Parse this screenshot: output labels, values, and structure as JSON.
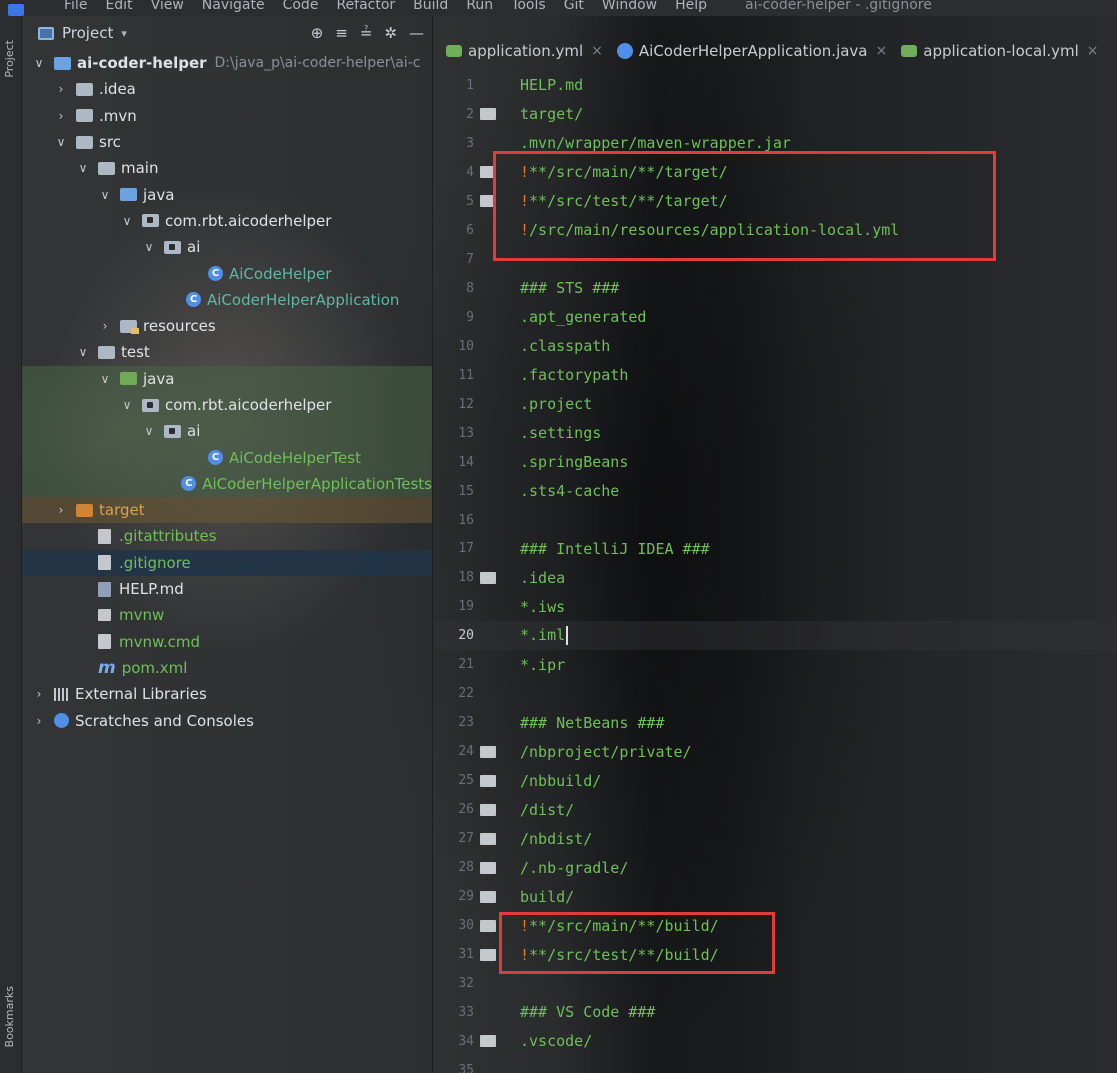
{
  "menu": {
    "items": [
      "File",
      "Edit",
      "View",
      "Navigate",
      "Code",
      "Refactor",
      "Build",
      "Run",
      "Tools",
      "Git",
      "Window",
      "Help"
    ],
    "window_title": "ai-coder-helper - .gitignore"
  },
  "toolstrip": {
    "top_label": "Project",
    "bottom_label": "Bookmarks"
  },
  "panel": {
    "title": "Project",
    "caret": "▾",
    "tools": [
      "⊕",
      "≡",
      "≟",
      "✲",
      "—"
    ]
  },
  "tree": [
    {
      "label": "ai-coder-helper",
      "path": "D:\\java_p\\ai-coder-helper\\ai-c",
      "indent": 0,
      "chev": "down",
      "icon": "proj",
      "style": "bold"
    },
    {
      "label": ".idea",
      "indent": 1,
      "chev": "right",
      "icon": "folder"
    },
    {
      "label": ".mvn",
      "indent": 1,
      "chev": "right",
      "icon": "folder"
    },
    {
      "label": "src",
      "indent": 1,
      "chev": "down",
      "icon": "folder"
    },
    {
      "label": "main",
      "indent": 2,
      "chev": "down",
      "icon": "folder"
    },
    {
      "label": "java",
      "indent": 3,
      "chev": "down",
      "icon": "folder-blue"
    },
    {
      "label": "com.rbt.aicoderhelper",
      "indent": 4,
      "chev": "down",
      "icon": "pkg"
    },
    {
      "label": "ai",
      "indent": 5,
      "chev": "down",
      "icon": "pkg"
    },
    {
      "label": "AiCodeHelper",
      "indent": 7,
      "chev": "none",
      "icon": "class",
      "style": "teal"
    },
    {
      "label": "AiCoderHelperApplication",
      "indent": 6,
      "chev": "none",
      "icon": "class",
      "style": "teal"
    },
    {
      "label": "resources",
      "indent": 3,
      "chev": "right",
      "icon": "res"
    },
    {
      "label": "test",
      "indent": 2,
      "chev": "down",
      "icon": "folder"
    },
    {
      "label": "java",
      "indent": 3,
      "chev": "down",
      "icon": "folder-green",
      "row": "hl-test"
    },
    {
      "label": "com.rbt.aicoderhelper",
      "indent": 4,
      "chev": "down",
      "icon": "pkg",
      "row": "hl-test"
    },
    {
      "label": "ai",
      "indent": 5,
      "chev": "down",
      "icon": "pkg",
      "row": "hl-test"
    },
    {
      "label": "AiCodeHelperTest",
      "indent": 7,
      "chev": "none",
      "icon": "class",
      "style": "green",
      "row": "hl-test"
    },
    {
      "label": "AiCoderHelperApplicationTests",
      "indent": 6,
      "chev": "none",
      "icon": "class",
      "style": "green",
      "row": "hl-test"
    },
    {
      "label": "target",
      "indent": 1,
      "chev": "right",
      "icon": "folder-orange",
      "style": "gold",
      "row": "hl-target"
    },
    {
      "label": ".gitattributes",
      "indent": 2,
      "chev": "none",
      "icon": "file",
      "style": "green"
    },
    {
      "label": ".gitignore",
      "indent": 2,
      "chev": "none",
      "icon": "file",
      "style": "green",
      "row": "sel"
    },
    {
      "label": "HELP.md",
      "indent": 2,
      "chev": "none",
      "icon": "md"
    },
    {
      "label": "mvnw",
      "indent": 2,
      "chev": "none",
      "icon": "mvnw",
      "style": "green"
    },
    {
      "label": "mvnw.cmd",
      "indent": 2,
      "chev": "none",
      "icon": "file",
      "style": "green"
    },
    {
      "label": "pom.xml",
      "indent": 2,
      "chev": "none",
      "icon": "maven",
      "style": "green"
    },
    {
      "label": "External Libraries",
      "indent": 0,
      "chev": "right",
      "icon": "lib"
    },
    {
      "label": "Scratches and Consoles",
      "indent": 0,
      "chev": "right",
      "icon": "scratch"
    }
  ],
  "tabs": [
    {
      "label": "application.yml",
      "icon": "yml",
      "close": "×"
    },
    {
      "label": "AiCoderHelperApplication.java",
      "icon": "java",
      "close": "×"
    },
    {
      "label": "application-local.yml",
      "icon": "yml",
      "close": "×"
    }
  ],
  "editor": {
    "current_line": 20,
    "lines": [
      {
        "n": "1",
        "text": "HELP.md",
        "fold": false
      },
      {
        "n": "2",
        "text": "target/",
        "fold": true
      },
      {
        "n": "3",
        "text": ".mvn/wrapper/maven-wrapper.jar",
        "fold": false
      },
      {
        "n": "4",
        "bang": "!",
        "text": "**/src/main/**/target/",
        "fold": true
      },
      {
        "n": "5",
        "bang": "!",
        "text": "**/src/test/**/target/",
        "fold": true
      },
      {
        "n": "6",
        "bang": "!",
        "text": "/src/main/resources/application-local.yml",
        "fold": false
      },
      {
        "n": "7",
        "text": "",
        "fold": false
      },
      {
        "n": "8",
        "text": "### STS ###",
        "fold": false
      },
      {
        "n": "9",
        "text": ".apt_generated",
        "fold": false
      },
      {
        "n": "10",
        "text": ".classpath",
        "fold": false
      },
      {
        "n": "11",
        "text": ".factorypath",
        "fold": false
      },
      {
        "n": "12",
        "text": ".project",
        "fold": false
      },
      {
        "n": "13",
        "text": ".settings",
        "fold": false
      },
      {
        "n": "14",
        "text": ".springBeans",
        "fold": false
      },
      {
        "n": "15",
        "text": ".sts4-cache",
        "fold": false
      },
      {
        "n": "16",
        "text": "",
        "fold": false
      },
      {
        "n": "17",
        "text": "### IntelliJ IDEA ###",
        "fold": false
      },
      {
        "n": "18",
        "text": ".idea",
        "fold": true
      },
      {
        "n": "19",
        "text": "*.iws",
        "fold": false
      },
      {
        "n": "20",
        "text": "*.iml",
        "fold": false
      },
      {
        "n": "21",
        "text": "*.ipr",
        "fold": false
      },
      {
        "n": "22",
        "text": "",
        "fold": false
      },
      {
        "n": "23",
        "text": "### NetBeans ###",
        "fold": false
      },
      {
        "n": "24",
        "text": "/nbproject/private/",
        "fold": true
      },
      {
        "n": "25",
        "text": "/nbbuild/",
        "fold": true
      },
      {
        "n": "26",
        "text": "/dist/",
        "fold": true
      },
      {
        "n": "27",
        "text": "/nbdist/",
        "fold": true
      },
      {
        "n": "28",
        "text": "/.nb-gradle/",
        "fold": true
      },
      {
        "n": "29",
        "text": "build/",
        "fold": true
      },
      {
        "n": "30",
        "bang": "!",
        "text": "**/src/main/**/build/",
        "fold": true
      },
      {
        "n": "31",
        "bang": "!",
        "text": "**/src/test/**/build/",
        "fold": true
      },
      {
        "n": "32",
        "text": "",
        "fold": false
      },
      {
        "n": "33",
        "text": "### VS Code ###",
        "fold": false
      },
      {
        "n": "34",
        "text": ".vscode/",
        "fold": true
      },
      {
        "n": "35",
        "text": "",
        "fold": false
      }
    ]
  },
  "colors": {
    "annotation_box": "#e03c3c",
    "code_text": "#6fbf5a",
    "negation": "#e07a2e",
    "selection": "#213448"
  }
}
